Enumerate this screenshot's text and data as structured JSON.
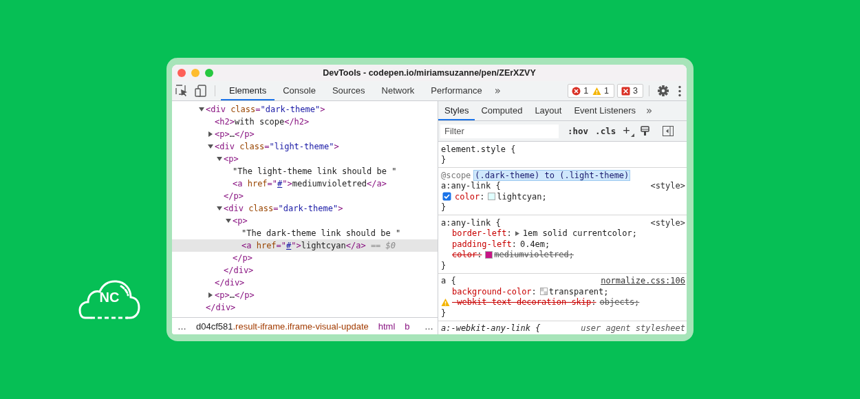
{
  "logo": {
    "text": "NC"
  },
  "window": {
    "title": "DevTools - codepen.io/miriamsuzanne/pen/ZErXZVY"
  },
  "toolbar": {
    "tabs": [
      {
        "label": "Elements",
        "selected": true
      },
      {
        "label": "Console",
        "selected": false
      },
      {
        "label": "Sources",
        "selected": false
      },
      {
        "label": "Network",
        "selected": false
      },
      {
        "label": "Performance",
        "selected": false
      }
    ],
    "overflow": "»",
    "badge_groups": [
      {
        "items": [
          {
            "kind": "error",
            "count": "1"
          },
          {
            "kind": "warning",
            "count": "1"
          }
        ]
      },
      {
        "items": [
          {
            "kind": "issue",
            "count": "3"
          }
        ]
      }
    ]
  },
  "elements": {
    "nodes": [
      {
        "kind": "parent",
        "expanded": true,
        "selected": false,
        "parts": [
          {
            "kind": "tag",
            "text": "<div"
          },
          {
            "kind": "attr",
            "text": " class"
          },
          {
            "kind": "tag",
            "text": "="
          },
          {
            "kind": "value",
            "text": "\"dark-theme\""
          },
          {
            "kind": "tag",
            "text": ">"
          }
        ],
        "close": [
          {
            "kind": "tag",
            "text": "</div>"
          }
        ],
        "children": [
          {
            "kind": "leaf",
            "selected": false,
            "parts": [
              {
                "kind": "tag",
                "text": "<h2>"
              },
              {
                "kind": "text",
                "text": "with scope"
              },
              {
                "kind": "tag",
                "text": "</h2>"
              }
            ]
          },
          {
            "kind": "parent",
            "expanded": false,
            "selected": false,
            "parts": [
              {
                "kind": "tag",
                "text": "<p>"
              },
              {
                "kind": "text",
                "text": "…"
              },
              {
                "kind": "tag",
                "text": "</p>"
              }
            ]
          },
          {
            "kind": "parent",
            "expanded": true,
            "selected": false,
            "parts": [
              {
                "kind": "tag",
                "text": "<div"
              },
              {
                "kind": "attr",
                "text": " class"
              },
              {
                "kind": "tag",
                "text": "="
              },
              {
                "kind": "value",
                "text": "\"light-theme\""
              },
              {
                "kind": "tag",
                "text": ">"
              }
            ],
            "close": [
              {
                "kind": "tag",
                "text": "</div>"
              }
            ],
            "children": [
              {
                "kind": "parent",
                "expanded": true,
                "selected": false,
                "parts": [
                  {
                    "kind": "tag",
                    "text": "<p>"
                  }
                ],
                "close": [
                  {
                    "kind": "tag",
                    "text": "</p>"
                  }
                ],
                "children": [
                  {
                    "kind": "leaf",
                    "selected": false,
                    "parts": [
                      {
                        "kind": "text",
                        "text": "\"The light-theme link should be \""
                      }
                    ]
                  },
                  {
                    "kind": "leaf",
                    "selected": false,
                    "parts": [
                      {
                        "kind": "tag",
                        "text": "<a"
                      },
                      {
                        "kind": "attr",
                        "text": " href"
                      },
                      {
                        "kind": "tag",
                        "text": "=\""
                      },
                      {
                        "kind": "link",
                        "text": "#"
                      },
                      {
                        "kind": "tag",
                        "text": "\">"
                      },
                      {
                        "kind": "text",
                        "text": "mediumvioletred"
                      },
                      {
                        "kind": "tag",
                        "text": "</a>"
                      }
                    ]
                  }
                ]
              },
              {
                "kind": "parent",
                "expanded": true,
                "selected": false,
                "parts": [
                  {
                    "kind": "tag",
                    "text": "<div"
                  },
                  {
                    "kind": "attr",
                    "text": " class"
                  },
                  {
                    "kind": "tag",
                    "text": "="
                  },
                  {
                    "kind": "value",
                    "text": "\"dark-theme\""
                  },
                  {
                    "kind": "tag",
                    "text": ">"
                  }
                ],
                "close": [
                  {
                    "kind": "tag",
                    "text": "</div>"
                  }
                ],
                "children": [
                  {
                    "kind": "parent",
                    "expanded": true,
                    "selected": false,
                    "parts": [
                      {
                        "kind": "tag",
                        "text": "<p>"
                      }
                    ],
                    "close": [
                      {
                        "kind": "tag",
                        "text": "</p>"
                      }
                    ],
                    "children": [
                      {
                        "kind": "leaf",
                        "selected": false,
                        "parts": [
                          {
                            "kind": "text",
                            "text": "\"The dark-theme link should be \""
                          }
                        ]
                      },
                      {
                        "kind": "leaf",
                        "selected": true,
                        "parts": [
                          {
                            "kind": "tag",
                            "text": "<a"
                          },
                          {
                            "kind": "attr",
                            "text": " href"
                          },
                          {
                            "kind": "tag",
                            "text": "=\""
                          },
                          {
                            "kind": "link",
                            "text": "#"
                          },
                          {
                            "kind": "tag",
                            "text": "\">"
                          },
                          {
                            "kind": "text",
                            "text": "lightcyan"
                          },
                          {
                            "kind": "tag",
                            "text": "</a>"
                          },
                          {
                            "kind": "ref",
                            "text": " == $0"
                          }
                        ]
                      }
                    ]
                  }
                ]
              }
            ]
          },
          {
            "kind": "parent",
            "expanded": false,
            "selected": false,
            "parts": [
              {
                "kind": "tag",
                "text": "<p>"
              },
              {
                "kind": "text",
                "text": "…"
              },
              {
                "kind": "tag",
                "text": "</p>"
              }
            ]
          }
        ]
      }
    ]
  },
  "breadcrumbs": {
    "more_left": "…",
    "items": [
      {
        "parts": [
          {
            "kind": "id",
            "text": "d04cf581"
          },
          {
            "kind": "class",
            "text": ".result-iframe.iframe-visual-update"
          }
        ]
      },
      {
        "parts": [
          {
            "kind": "tag",
            "text": "html"
          }
        ]
      },
      {
        "parts": [
          {
            "kind": "tag",
            "text": "b"
          }
        ]
      }
    ],
    "more_right": "…"
  },
  "styles": {
    "tabs": [
      {
        "label": "Styles",
        "selected": true
      },
      {
        "label": "Computed",
        "selected": false
      },
      {
        "label": "Layout",
        "selected": false
      },
      {
        "label": "Event Listeners",
        "selected": false
      }
    ],
    "overflow": "»",
    "filter": {
      "placeholder": "Filter"
    },
    "buttons": [
      ":hov",
      ".cls",
      "+"
    ],
    "rules": [
      {
        "selector": "element.style {",
        "close": "}"
      },
      {
        "scope": {
          "keyword": "@scope",
          "range": "(.dark-theme) to (.light-theme)"
        },
        "selector": "a:any-link {",
        "source": {
          "kind": "plain",
          "text": "<style>"
        },
        "close": "}",
        "declarations": [
          {
            "kind": "toggle",
            "checked": true,
            "property": "color",
            "colon": ":",
            "swatch": {
              "kind": "color",
              "color": "#e0ffff"
            },
            "value": "lightcyan;",
            "overridden": false
          }
        ]
      },
      {
        "selector": "a:any-link {",
        "source": {
          "kind": "plain",
          "text": "<style>"
        },
        "close": "}",
        "declarations": [
          {
            "kind": "plain",
            "property": "border-left",
            "colon": ":",
            "value": "1em solid currentcolor;",
            "overridden": false,
            "expandable": true
          },
          {
            "kind": "plain",
            "property": "padding-left",
            "colon": ":",
            "value": "0.4em;",
            "overridden": false
          },
          {
            "kind": "plain",
            "property": "color",
            "colon": ":",
            "swatch": {
              "kind": "color",
              "color": "#c71585"
            },
            "value": "mediumvioletred;",
            "overridden": true
          }
        ]
      },
      {
        "selector": "a {",
        "source": {
          "kind": "link",
          "text": "normalize.css:106"
        },
        "close": "}",
        "declarations": [
          {
            "kind": "plain",
            "property": "background-color",
            "colon": ":",
            "swatch": {
              "kind": "transparent"
            },
            "value": "transparent;",
            "overridden": false
          },
          {
            "kind": "plain",
            "property": "-webkit-text-decoration-skip",
            "colon": ":",
            "value": "objects;",
            "overridden": true,
            "warning": true
          }
        ]
      },
      {
        "selector": "a:-webkit-any-link {",
        "source": {
          "kind": "italic",
          "text": "user agent stylesheet"
        }
      }
    ]
  }
}
